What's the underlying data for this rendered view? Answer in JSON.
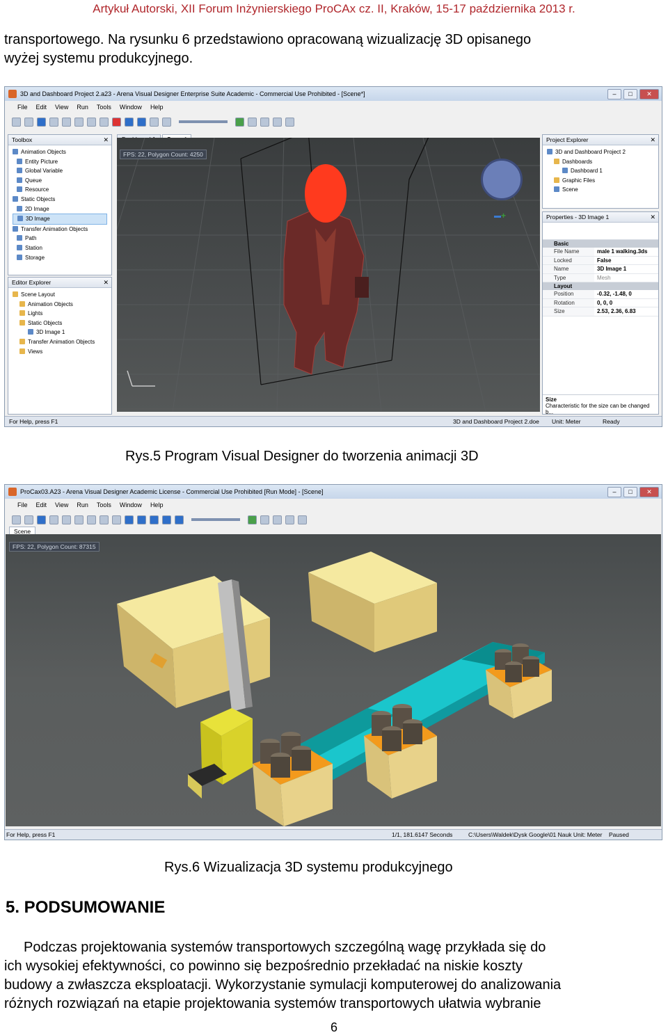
{
  "header": "Artykuł Autorski, XII Forum Inżynierskiego ProCAx cz. II, Kraków, 15-17 października 2013 r.",
  "intro_lines": [
    "transportowego. Na rysunku 6 przedstawiono opracowaną wizualizację 3D opisanego",
    "wyżej systemu produkcyjnego."
  ],
  "figure1": {
    "title": "3D and Dashboard Project 2.a23 - Arena Visual Designer Enterprise Suite Academic - Commercial Use Prohibited - [Scene*]",
    "menu": [
      "File",
      "Edit",
      "View",
      "Run",
      "Tools",
      "Window",
      "Help"
    ],
    "toolbox": {
      "title": "Toolbox",
      "items": [
        "Animation Objects",
        "Entity Picture",
        "Global Variable",
        "Queue",
        "Resource",
        "Static Objects",
        "2D Image",
        "3D Image",
        "Transfer Animation Objects",
        "Path",
        "Station",
        "Storage"
      ]
    },
    "editor_explorer": {
      "title": "Editor Explorer",
      "items": [
        "Scene Layout",
        "Animation Objects",
        "Lights",
        "Static Objects",
        "3D Image 1",
        "Transfer Animation Objects",
        "Views"
      ]
    },
    "tabs": [
      "Dashboard 1",
      "Scene*"
    ],
    "fps": "FPS: 22, Polygon Count: 4250",
    "project_explorer": {
      "title": "Project Explorer",
      "items": [
        "3D and Dashboard Project 2",
        "Dashboards",
        "Dashboard 1",
        "Graphic Files",
        "Scene"
      ]
    },
    "properties": {
      "title": "Properties - 3D Image 1",
      "basic_label": "Basic",
      "layout_label": "Layout",
      "rows_basic": [
        {
          "k": "File Name",
          "v": "male 1 walking.3ds"
        },
        {
          "k": "Locked",
          "v": "False"
        },
        {
          "k": "Name",
          "v": "3D Image 1"
        },
        {
          "k": "Type",
          "v": "Mesh"
        }
      ],
      "rows_layout": [
        {
          "k": "Position",
          "v": "-0.32, -1.48, 0"
        },
        {
          "k": "Rotation",
          "v": "0, 0, 0"
        },
        {
          "k": "Size",
          "v": "2.53, 2.36, 6.83"
        }
      ],
      "help_title": "Size",
      "help_text": "Characteristic for the size can be changed b..."
    },
    "status": {
      "left": "For Help, press F1",
      "doc": "3D and Dashboard Project 2.doe",
      "unit": "Unit: Meter",
      "state": "Ready"
    }
  },
  "caption1": "Rys.5 Program Visual Designer do tworzenia animacji 3D",
  "figure2": {
    "title": "ProCax03.A23 - Arena Visual Designer Academic License - Commercial Use Prohibited [Run Mode] - [Scene]",
    "menu": [
      "File",
      "Edit",
      "View",
      "Run",
      "Tools",
      "Window",
      "Help"
    ],
    "tab": "Scene",
    "fps": "FPS: 22, Polygon Count: 87315",
    "status": {
      "left": "For Help, press F1",
      "time": "1/1, 181.6147 Seconds",
      "path": "C:\\Users\\Waldek\\Dysk Google\\01 Nauk Unit: Meter",
      "state": "Paused"
    }
  },
  "caption2": "Rys.6 Wizualizacja 3D systemu produkcyjnego",
  "section": "5. PODSUMOWANIE",
  "body_lines": [
    "Podczas projektowania systemów transportowych szczególną wagę przykłada się do",
    "ich wysokiej efektywności, co powinno się bezpośrednio przekładać na niskie koszty",
    "budowy a zwłaszcza eksploatacji. Wykorzystanie symulacji komputerowej do analizowania",
    "różnych rozwiązań na etapie projektowania systemów transportowych ułatwia wybranie"
  ],
  "page_number": "6"
}
